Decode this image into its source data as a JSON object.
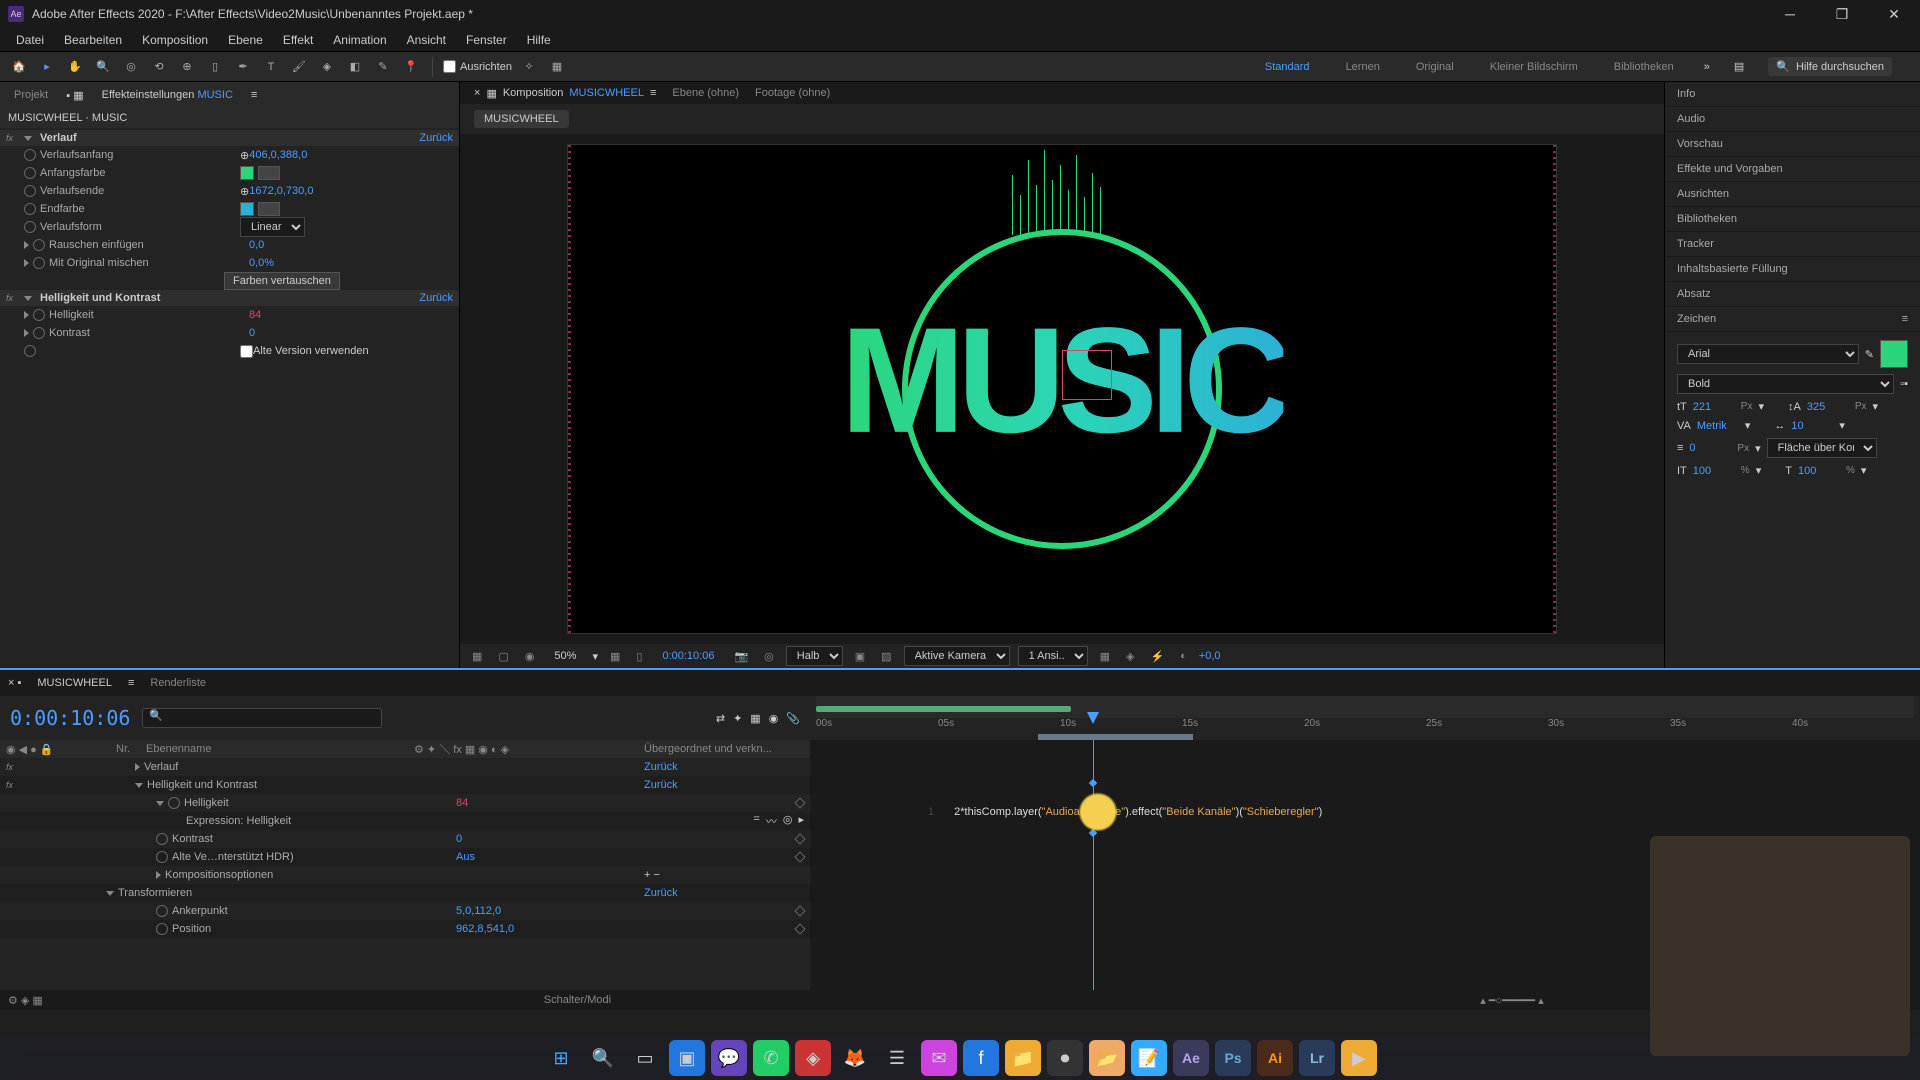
{
  "titlebar": {
    "app_logo": "Ae",
    "title": "Adobe After Effects 2020 - F:\\After Effects\\Video2Music\\Unbenanntes Projekt.aep *"
  },
  "menu": [
    "Datei",
    "Bearbeiten",
    "Komposition",
    "Ebene",
    "Effekt",
    "Animation",
    "Ansicht",
    "Fenster",
    "Hilfe"
  ],
  "toolbar": {
    "align_label": "Ausrichten",
    "workspaces": [
      "Standard",
      "Lernen",
      "Original",
      "Kleiner Bildschirm",
      "Bibliotheken"
    ],
    "active_workspace": "Standard",
    "search_placeholder": "Hilfe durchsuchen"
  },
  "left_panel": {
    "tabs": {
      "project": "Projekt",
      "effect_controls": "Effekteinstellungen",
      "effect_target": "MUSIC"
    },
    "breadcrumb": "MUSICWHEEL · MUSIC",
    "effects": [
      {
        "name": "Verlauf",
        "reset": "Zurück",
        "props": [
          {
            "label": "Verlaufsanfang",
            "value": "406,0,388,0",
            "type": "point"
          },
          {
            "label": "Anfangsfarbe",
            "value": "",
            "type": "color",
            "color": "#2bd67b"
          },
          {
            "label": "Verlaufsende",
            "value": "1672,0,730,0",
            "type": "point"
          },
          {
            "label": "Endfarbe",
            "value": "",
            "type": "color",
            "color": "#2bb1d6"
          },
          {
            "label": "Verlaufsform",
            "value": "Linear",
            "type": "select"
          },
          {
            "label": "Rauschen einfügen",
            "value": "0,0",
            "type": "number"
          },
          {
            "label": "Mit Original mischen",
            "value": "0,0%",
            "type": "number"
          }
        ],
        "swap_btn": "Farben vertauschen"
      },
      {
        "name": "Helligkeit und Kontrast",
        "reset": "Zurück",
        "props": [
          {
            "label": "Helligkeit",
            "value": "84",
            "type": "expr"
          },
          {
            "label": "Kontrast",
            "value": "0",
            "type": "number"
          },
          {
            "label": "Alte Version verwenden",
            "value": "",
            "type": "check"
          }
        ]
      }
    ]
  },
  "comp_panel": {
    "tabs": [
      {
        "label": "Komposition",
        "target": "MUSICWHEEL",
        "active": true
      },
      {
        "label": "Ebene (ohne)"
      },
      {
        "label": "Footage (ohne)"
      }
    ],
    "crumb": "MUSICWHEEL",
    "canvas_text": "MUSIC"
  },
  "viewer_controls": {
    "zoom": "50%",
    "time": "0:00:10:06",
    "res": "Halb",
    "camera": "Aktive Kamera",
    "views": "1 Ansi...",
    "exposure": "+0,0"
  },
  "right_panel": {
    "sections": [
      "Info",
      "Audio",
      "Vorschau",
      "Effekte und Vorgaben",
      "Ausrichten",
      "Bibliotheken",
      "Tracker",
      "Inhaltsbasierte Füllung",
      "Absatz"
    ],
    "char": {
      "title": "Zeichen",
      "font": "Arial",
      "weight": "Bold",
      "size": "221",
      "size_unit": "Px",
      "leading": "325",
      "leading_unit": "Px",
      "kerning": "Metrik",
      "tracking": "10",
      "stroke": "0",
      "stroke_unit": "Px",
      "fill_mode": "Fläche über Kon...",
      "scale_v": "100",
      "scale_h": "100",
      "swatch": "#2bd67b"
    }
  },
  "timeline": {
    "tabs": {
      "main": "MUSICWHEEL",
      "render": "Renderliste"
    },
    "timecode": "0:00:10:06",
    "cols": {
      "nr": "Nr.",
      "name": "Ebenenname",
      "parent": "Übergeordnet und verkn..."
    },
    "ticks": [
      "00s",
      "05s",
      "10s",
      "15s",
      "20s",
      "25s",
      "30s",
      "35s",
      "40s"
    ],
    "rows": [
      {
        "label": "Verlauf",
        "value": "Zurück",
        "indent": 1,
        "tri": "closed"
      },
      {
        "label": "Helligkeit und Kontrast",
        "value": "Zurück",
        "indent": 1,
        "tri": "open"
      },
      {
        "label": "Helligkeit",
        "value": "84",
        "indent": 2,
        "expr": true
      },
      {
        "label": "Expression: Helligkeit",
        "value": "",
        "indent": 3,
        "btns": true
      },
      {
        "label": "Kontrast",
        "value": "0",
        "indent": 2
      },
      {
        "label": "Alte Ve…nterstützt HDR)",
        "value": "Aus",
        "indent": 2
      },
      {
        "label": "Kompositionsoptionen",
        "value": "+ −",
        "indent": 2,
        "tri": "closed"
      },
      {
        "label": "Transformieren",
        "value": "Zurück",
        "indent": 1,
        "tri": "open"
      },
      {
        "label": "Ankerpunkt",
        "value": "5,0,112,0",
        "indent": 2
      },
      {
        "label": "Position",
        "value": "962,8,541,0",
        "indent": 2
      }
    ],
    "expression": {
      "line": "1",
      "prefix": "2*",
      "fn1": "thisComp.layer(",
      "str1": "\"Audioamplitude\"",
      "fn2": ").effect(",
      "str2": "\"Beide Kanäle\"",
      "fn3": ")(",
      "str3": "\"Schieberegler\"",
      "fn4": ")"
    },
    "footer": "Schalter/Modi"
  },
  "taskbar": {
    "icons": [
      "⊞",
      "🔍",
      "▭",
      "▣",
      "💬",
      "✆",
      "◈",
      "🦊",
      "☰",
      "✉",
      "f",
      "📁",
      "⏺",
      "📂",
      "📝",
      "Ae",
      "Ps",
      "Ai",
      "Lr",
      "▶"
    ]
  }
}
